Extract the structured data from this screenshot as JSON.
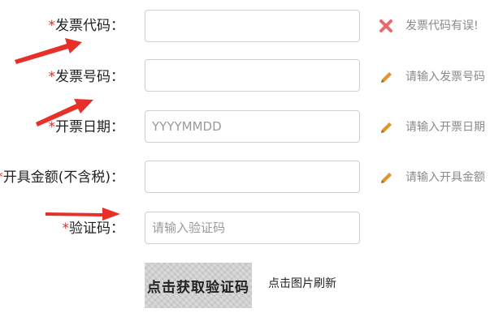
{
  "form": {
    "required_mark": "*",
    "fields": [
      {
        "label": "发票代码：",
        "value": "",
        "placeholder": "",
        "hint": "发票代码有误!",
        "hint_icon": "error-x-icon",
        "hint_color": "#e86a6a"
      },
      {
        "label": "发票号码：",
        "value": "",
        "placeholder": "",
        "hint": "请输入发票号码",
        "hint_icon": "pencil-icon"
      },
      {
        "label": "开票日期：",
        "value": "",
        "placeholder": "YYYYMMDD",
        "hint": "请输入开票日期",
        "hint_icon": "pencil-icon"
      },
      {
        "label": "开具金额(不含税)：",
        "value": "",
        "placeholder": "",
        "hint": "请输入开具金额",
        "hint_icon": "pencil-icon"
      },
      {
        "label": "验证码：",
        "value": "",
        "placeholder": "请输入验证码"
      }
    ],
    "captcha": {
      "text": "点击获取验证码",
      "refresh_label": "点击图片刷新"
    }
  },
  "colors": {
    "required": "#e02b2b",
    "arrow": "#e8302a",
    "error_icon": "#e86a6a",
    "pencil": "#e0962a"
  }
}
